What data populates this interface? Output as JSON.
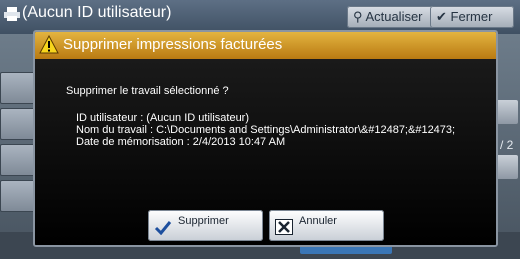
{
  "background": {
    "title": "(Aucun ID utilisateur)",
    "refresh_label": "Actualiser",
    "close_label": "Fermer",
    "page_indicator": "/ 2"
  },
  "dialog": {
    "title": "Supprimer impressions facturées",
    "question": "Supprimer le travail sélectionné ?",
    "user_id_line": "ID utilisateur : (Aucun ID utilisateur)",
    "job_name_line": "Nom du travail : C:\\Documents and Settings\\Administrator\\&#12487;&#12473;",
    "date_line": "Date de mémorisation : 2/4/2013 10:47 AM",
    "delete_label": "Supprimer",
    "cancel_label": "Annuler"
  },
  "colors": {
    "header_accent": "#e3b440",
    "dialog_background": "#000000"
  },
  "icons": {
    "warning": "warning-triangle-icon",
    "delete": "checkmark-icon",
    "cancel": "close-x-icon",
    "printer": "printer-icon",
    "refresh": "magnifier-icon",
    "close": "checkmark-icon"
  }
}
